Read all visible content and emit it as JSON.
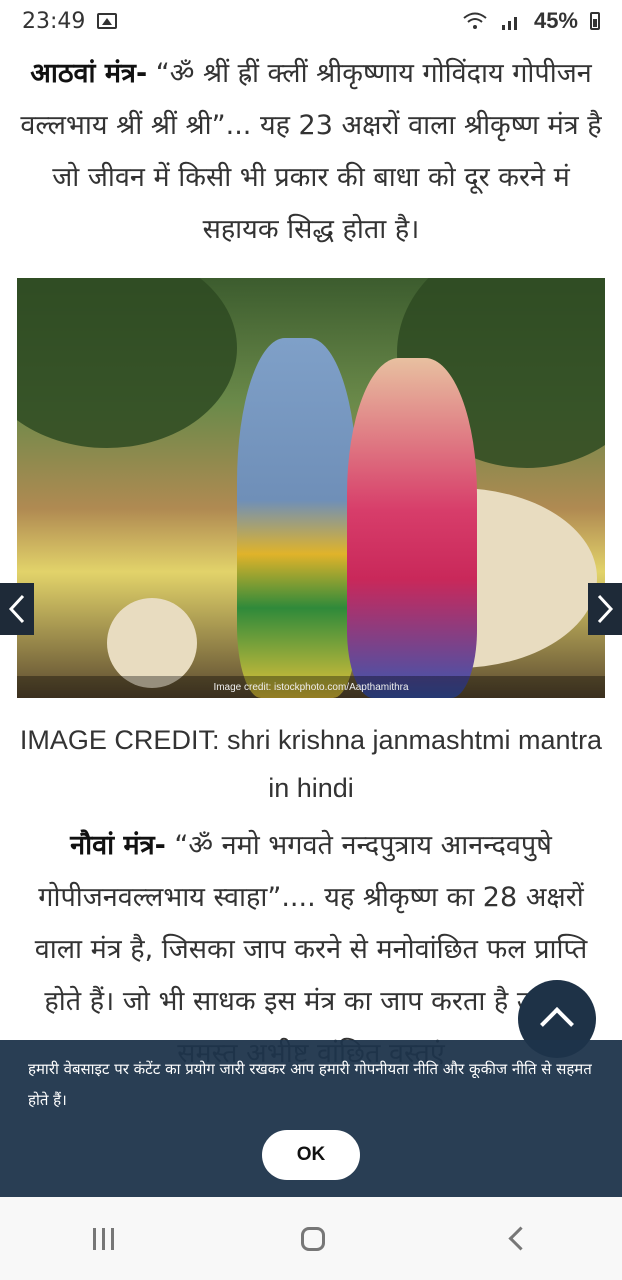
{
  "status_bar": {
    "time": "23:49",
    "battery_percent": "45%"
  },
  "article": {
    "para1_bold": "आठवां मंत्र-",
    "para1_text": " “ॐ श्रीं ह्रीं क्लीं श्रीकृष्णाय गोविंदाय गोपीजन वल्लभाय श्रीं श्रीं श्री”... यह 23 अक्षरों वाला श्रीकृष्ण मंत्र है जो जीवन में किसी भी प्रकार की बाधा को दूर करने मं सहायक सिद्ध होता है।",
    "image_credit_overlay": "Image credit: istockphoto.com/Aapthamithra",
    "caption": "IMAGE CREDIT: shri krishna janmashtmi mantra in hindi",
    "para2_bold": "नौवां मंत्र-",
    "para2_text": " “ॐ नमो भगवते नन्दपुत्राय आनन्दवपुषे गोपीजनवल्लभाय स्वाहा”.... यह श्रीकृष्ण का 28 अक्षरों वाला मंत्र है, जिसका जाप करने से मनोवांछित फल प्राप्ति होते हैं। जो भी साधक इस मंत्र का जाप करता है उसको समस्त अभीष्ट वांछित वस्तुएं"
  },
  "gallery": {
    "prev_icon": "chevron-left-icon",
    "next_icon": "chevron-right-icon"
  },
  "cookie_banner": {
    "text": "हमारी वेबसाइट पर कंटेंट का प्रयोग जारी रखकर आप हमारी गोपनीयता नीति और कूकीज नीति से सहमत होते हैं।",
    "ok_label": "OK"
  },
  "colors": {
    "banner_bg": "#1e344b",
    "scroll_btn": "#1e3247",
    "gallery_btn": "#1e2a38"
  }
}
